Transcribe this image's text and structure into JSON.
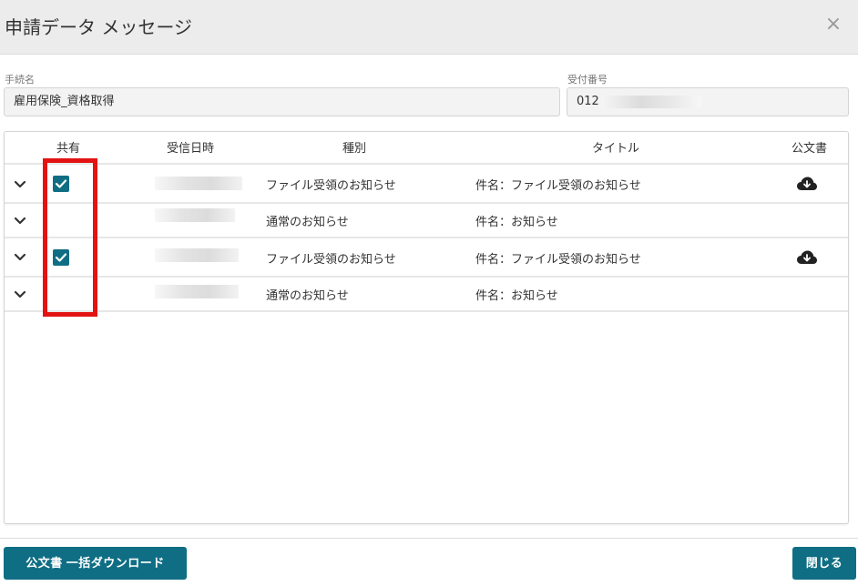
{
  "dialog": {
    "title": "申請データ メッセージ",
    "close_symbol": "×"
  },
  "fields": {
    "procedure_name_label": "手続名",
    "procedure_name_value": "雇用保険_資格取得",
    "receipt_number_label": "受付番号",
    "receipt_number_value": "012"
  },
  "table": {
    "headers": {
      "share": "共有",
      "received_datetime": "受信日時",
      "type": "種別",
      "title": "タイトル",
      "official_document": "公文書"
    },
    "rows": [
      {
        "shared": true,
        "type": "ファイル受領のお知らせ",
        "title": "件名：ファイル受領のお知らせ",
        "has_document": true
      },
      {
        "shared": false,
        "type": "通常のお知らせ",
        "title": "件名：お知らせ",
        "has_document": false
      },
      {
        "shared": true,
        "type": "ファイル受領のお知らせ",
        "title": "件名：ファイル受領のお知らせ",
        "has_document": true
      },
      {
        "shared": false,
        "type": "通常のお知らせ",
        "title": "件名：お知らせ",
        "has_document": false
      }
    ]
  },
  "buttons": {
    "bulk_download": "公文書 一括ダウンロード",
    "close": "閉じる"
  },
  "colors": {
    "accent": "#0f6e84",
    "highlight": "#e31313",
    "header_bg": "#ececec"
  },
  "icons": {
    "expand": "chevron-down-icon",
    "checkbox": "checkmark-icon",
    "document": "cloud-download-icon",
    "close": "close-icon"
  }
}
